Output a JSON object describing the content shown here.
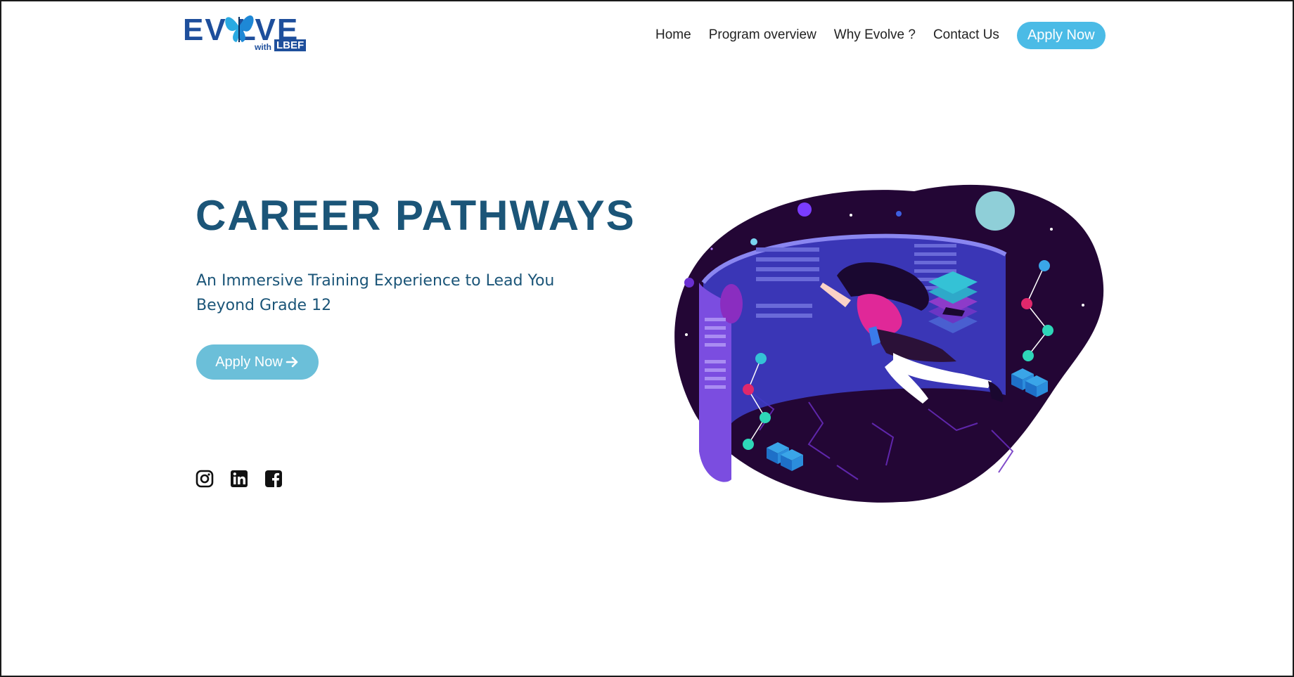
{
  "brand": {
    "logo_text": "EV LVE",
    "logo_with": "with",
    "logo_lbef": "LBEF",
    "colors": {
      "primary": "#1e4f9c",
      "accent": "#4bbbe6"
    }
  },
  "nav": {
    "items": [
      "Home",
      "Program overview",
      "Why Evolve ?",
      "Contact Us"
    ],
    "cta": "Apply Now"
  },
  "hero": {
    "title": "CAREER PATHWAYS",
    "subtitle": "An Immersive Training Experience to Lead You Beyond Grade 12",
    "button_label": "Apply Now",
    "button_icon": "arrow-right-icon",
    "title_color": "#1b5578",
    "button_color": "#6bbfd9"
  },
  "socials": [
    "instagram-icon",
    "linkedin-icon",
    "facebook-icon"
  ],
  "illustration": {
    "icon": "virtual-reality-illustration",
    "bg_color": "#230635"
  }
}
